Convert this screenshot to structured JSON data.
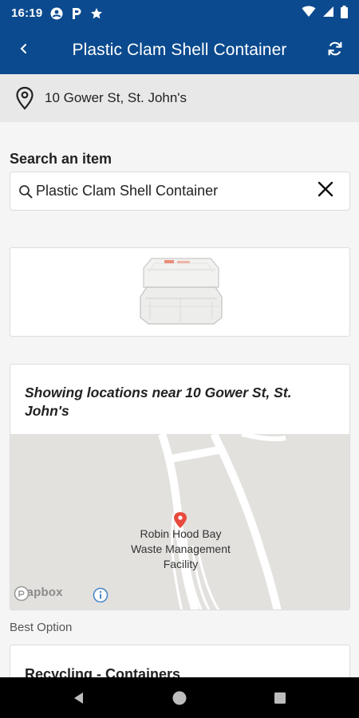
{
  "status_bar": {
    "time": "16:19",
    "left_icons": [
      "account-circle-icon",
      "parking-icon",
      "star-icon"
    ],
    "right_icons": [
      "wifi-icon",
      "signal-icon",
      "battery-icon"
    ]
  },
  "app_bar": {
    "title": "Plastic Clam Shell Container",
    "back_icon": "chevron-left-icon",
    "refresh_icon": "refresh-icon",
    "background": "#0b4a8e"
  },
  "location": {
    "icon": "location-pin-icon",
    "address": "10 Gower St, St. John's"
  },
  "search": {
    "label": "Search an item",
    "value": "Plastic Clam Shell Container",
    "search_icon": "search-icon",
    "clear_icon": "close-icon"
  },
  "item_image": {
    "description_icon": "clamshell-container-image"
  },
  "map_card": {
    "heading": "Showing locations near 10 Gower St, St. John's",
    "marker_label_lines": [
      "Robin Hood Bay",
      "Waste Management",
      "Facility"
    ],
    "attribution": "mapbox",
    "marker_color": "#e84a3d"
  },
  "results": {
    "best_label": "Best Option",
    "first_option_title": "Recycling - Containers"
  },
  "nav_bar": {
    "buttons": [
      "back-triangle-icon",
      "home-circle-icon",
      "recents-square-icon"
    ]
  }
}
